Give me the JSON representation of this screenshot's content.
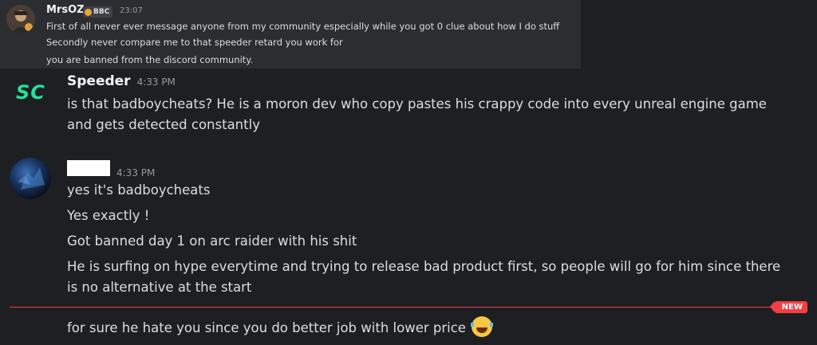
{
  "quoted_message": {
    "username": "MrsOZ",
    "tag": "BBC",
    "time": "23:07",
    "lines": [
      "First of all never ever message anyone from my community especially while you got 0 clue about how I do stuff",
      "Secondly never compare me to that speeder retard you work for",
      "you are banned from the discord community."
    ]
  },
  "message_1": {
    "logo_text": "SC",
    "username": "Speeder",
    "time": "4:33 PM",
    "lines": [
      "is that badboycheats? He is a moron dev who copy pastes his crappy code into every unreal engine game",
      "and gets detected constantly"
    ]
  },
  "message_2": {
    "time": "4:33 PM",
    "lines": [
      "yes it's badboycheats",
      "Yes exactly !",
      "Got banned day 1 on arc raider with his shit",
      "He is surfing on hype everytime and trying to release bad product first, so people will go for him since there",
      "is no alternative at the start"
    ]
  },
  "divider": {
    "label": "NEW",
    "color": "#f23f43"
  },
  "message_3": {
    "text": "for sure he hate you since you do better job with lower price",
    "emoji": "joy-emoji"
  }
}
